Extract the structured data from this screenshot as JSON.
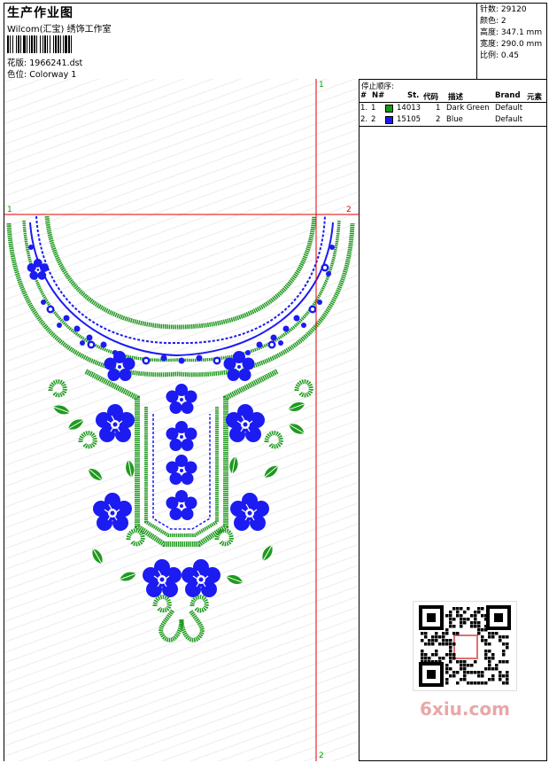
{
  "header": {
    "title": "生产作业图",
    "studio": "Wilcom(汇宝) 绣饰工作室",
    "design_label": "花版:",
    "design_file": "1966241.dst",
    "color_label": "色位:",
    "colorway": "Colorway 1"
  },
  "stats": [
    {
      "label": "针数:",
      "value": "29120"
    },
    {
      "label": "颜色:",
      "value": "2"
    },
    {
      "label": "高度:",
      "value": "347.1 mm"
    },
    {
      "label": "宽度:",
      "value": "290.0 mm"
    },
    {
      "label": "比例:",
      "value": "0.45"
    }
  ],
  "stop_sequence": {
    "title": "停止顺序:",
    "columns": [
      "#",
      "N#",
      "St.",
      "代码",
      "描述",
      "Brand",
      "元素"
    ],
    "rows": [
      {
        "seq": "1.",
        "needle": "1",
        "stitches": "14013",
        "code": "1",
        "description": "Dark Green",
        "brand": "Default",
        "color": "#119911"
      },
      {
        "seq": "2.",
        "needle": "2",
        "stitches": "15105",
        "code": "2",
        "description": "Blue",
        "brand": "Default",
        "color": "#1a1af0"
      }
    ]
  },
  "guides": {
    "vertical_top": "1",
    "vertical_bottom": "2",
    "horizontal_left": "1",
    "horizontal_right": "2"
  },
  "colors": {
    "green": "#1e9a1e",
    "blue": "#1b1bf2",
    "guide": "#e00000",
    "guide_label": "#00a000"
  },
  "watermark": "6xiu.com"
}
